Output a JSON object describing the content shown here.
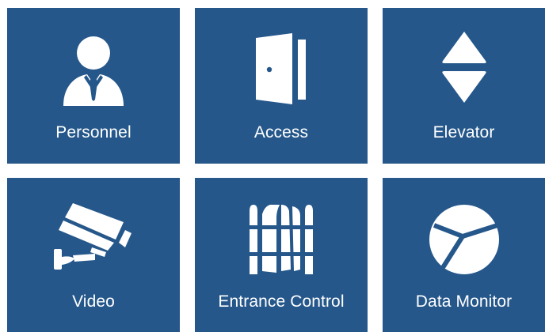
{
  "tiles": [
    {
      "label": "Personnel",
      "icon": "person-icon"
    },
    {
      "label": "Access",
      "icon": "door-icon"
    },
    {
      "label": "Elevator",
      "icon": "elevator-arrows-icon"
    },
    {
      "label": "Video",
      "icon": "security-camera-icon"
    },
    {
      "label": "Entrance Control",
      "icon": "turnstile-gate-icon"
    },
    {
      "label": "Data Monitor",
      "icon": "pie-chart-icon"
    }
  ],
  "colors": {
    "tile_background": "#25578a",
    "tile_foreground": "#ffffff",
    "page_background": "#ffffff"
  }
}
